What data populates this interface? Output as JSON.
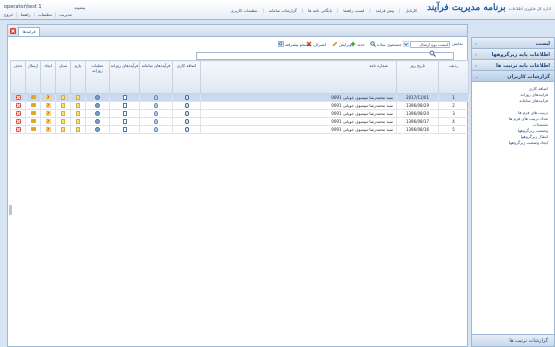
{
  "header": {
    "logo_text": "برنامه مدیریت فرآیند",
    "logo_sub": "اداره کل فناوری اطلاعات",
    "menu": [
      "کارتابل",
      "پیش فرایند",
      "لیست راهنما",
      "بایگانی نامه ها",
      "گزارشات سامانه",
      "تنظیمات کاربری"
    ],
    "user_name": "operator\\test 1",
    "links": [
      "خروج",
      "راهنما",
      "تنظیمات",
      "مدیریت"
    ],
    "lang": "پیشوند"
  },
  "tab": {
    "label": "فرایندها"
  },
  "toolbar": {
    "filter_label": "نمایش",
    "filter_value": "لیست نوع ارسال",
    "search_label": "جستجوی ساده",
    "new_label": "جدید",
    "edit_label": "ویرایش",
    "cancel_label": "انصراف",
    "advanced_label": "جستجو پیشرفته"
  },
  "table": {
    "headers": [
      "حذف",
      "ارسال",
      "ایجاد",
      "تبدیل",
      "پارو",
      "عملیات روزانه",
      "فرآیندهای روزانه",
      "فرآیندهای سامانه",
      "اضافه کاری",
      "شماره نامه",
      "تاریخ روز",
      "ردیف"
    ],
    "rows": [
      {
        "row": "1",
        "date": "2017/11/01",
        "num": "9091",
        "title": "سید محمدرضا موسوی خوبانی"
      },
      {
        "row": "2",
        "date": "1396/08/29",
        "num": "9091",
        "title": "سید محمدرضا موسوی خوبانی"
      },
      {
        "row": "3",
        "date": "1396/08/20",
        "num": "9091",
        "title": "سید محمدرضا موسوی خوبانی"
      },
      {
        "row": "4",
        "date": "1396/08/17",
        "num": "9091",
        "title": "سید محمدرضا موسوی خوبانی"
      },
      {
        "row": "5",
        "date": "1396/08/16",
        "num": "9091",
        "title": "سید محمدرضا موسوی خوبانی"
      }
    ]
  },
  "sidebar": {
    "sections": [
      "لیست",
      "اطلاعات پایه زیرگروهها",
      "اطلاعات پایه ترتیب ها",
      "گزارشات کاربران"
    ],
    "items1": [
      "اضافه کاری",
      "فرایندهای روزانه",
      "فرایندهای سامانه"
    ],
    "items2": [
      "ترتیب های فرم ها",
      "تعداد ترتیب های فرم ها",
      "مستندات",
      "وضعیت زیرگروهها",
      "انتقال زیرگروهها",
      "ایجاد وضعیت زیرگروهها"
    ],
    "footer": "گزارشات ترتیب ها"
  }
}
